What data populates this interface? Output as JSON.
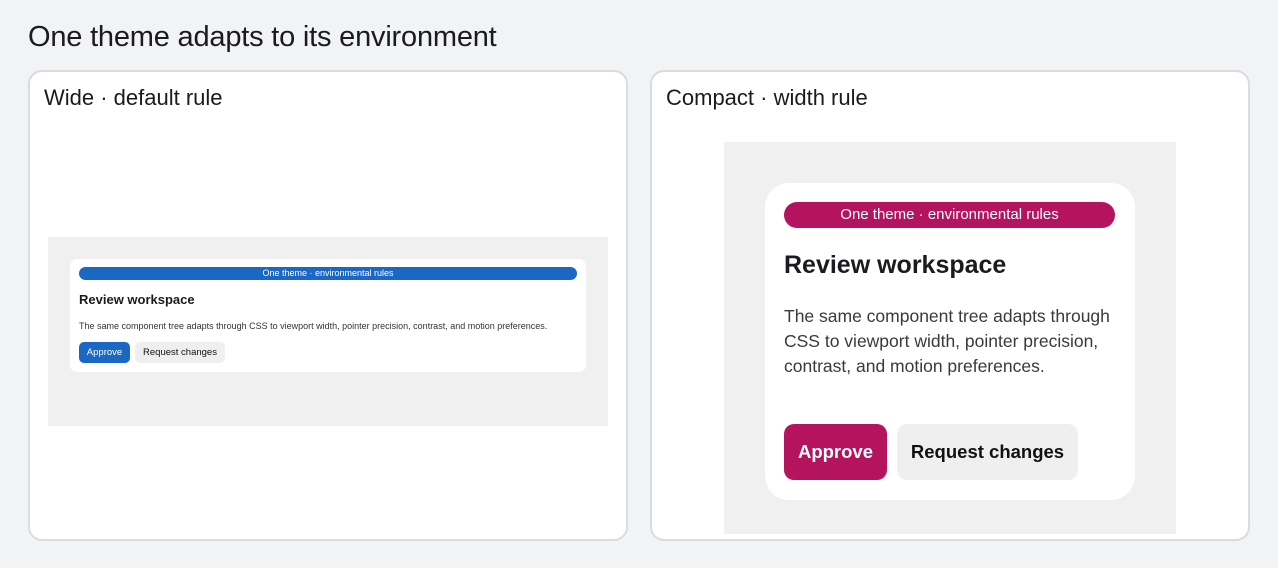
{
  "page": {
    "title": "One theme adapts to its environment"
  },
  "panels": {
    "wide": {
      "label": "Wide · default rule",
      "accent": "#1a67c4",
      "card": {
        "badge": "One theme · environmental rules",
        "heading": "Review workspace",
        "body": "The same component tree adapts through CSS to viewport width, pointer precision, contrast, and motion preferences.",
        "approve_label": "Approve",
        "request_label": "Request changes"
      }
    },
    "compact": {
      "label": "Compact · width rule",
      "accent": "#b4145e",
      "card": {
        "badge": "One theme · environmental rules",
        "heading": "Review workspace",
        "body": "The same component tree adapts through CSS to viewport width, pointer precision, contrast, and motion preferences.",
        "approve_label": "Approve",
        "request_label": "Request changes"
      }
    }
  }
}
